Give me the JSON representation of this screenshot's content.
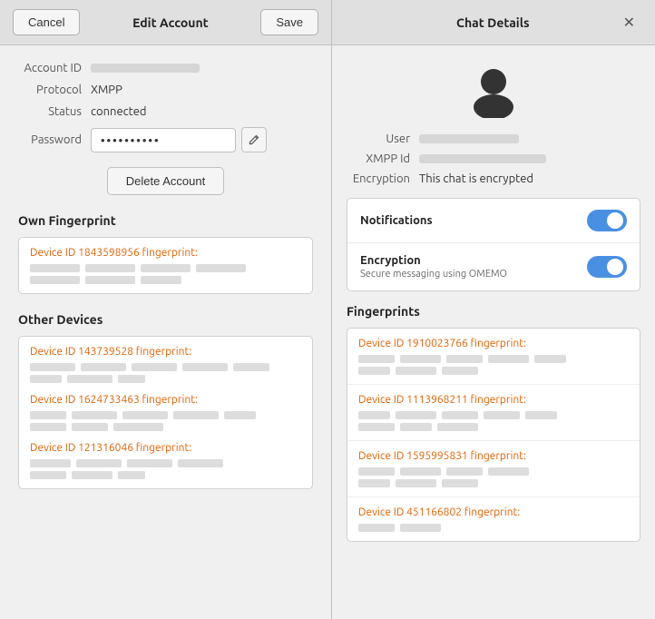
{
  "left": {
    "header": {
      "cancel_label": "Cancel",
      "title": "Edit Account",
      "save_label": "Save"
    },
    "form": {
      "account_id_label": "Account ID",
      "protocol_label": "Protocol",
      "protocol_value": "XMPP",
      "status_label": "Status",
      "status_value": "connected",
      "password_label": "Password",
      "password_value": "••••••••••"
    },
    "delete_label": "Delete Account",
    "own_fingerprint": {
      "title": "Own Fingerprint",
      "device_line": "Device ID 1843598956 fingerprint:"
    },
    "other_devices": {
      "title": "Other Devices",
      "devices": [
        {
          "line": "Device ID 143739528 fingerprint:"
        },
        {
          "line": "Device ID 1624733463 fingerprint:"
        },
        {
          "line": "Device ID 121316046 fingerprint:"
        }
      ]
    }
  },
  "right": {
    "header": {
      "title": "Chat Details",
      "close_label": "✕"
    },
    "user_label": "User",
    "xmpp_id_label": "XMPP Id",
    "encryption_label": "Encryption",
    "encryption_value": "This chat is encrypted",
    "notifications": {
      "label": "Notifications",
      "enabled": true
    },
    "encryption_toggle": {
      "label": "Encryption",
      "sublabel": "Secure messaging using OMEMO",
      "enabled": true
    },
    "fingerprints": {
      "title": "Fingerprints",
      "devices": [
        {
          "line": "Device ID 1910023766 fingerprint:"
        },
        {
          "line": "Device ID 1113968211 fingerprint:"
        },
        {
          "line": "Device ID 1595995831 fingerprint:"
        },
        {
          "line": "Device ID 451166802 fingerprint:"
        }
      ]
    }
  }
}
